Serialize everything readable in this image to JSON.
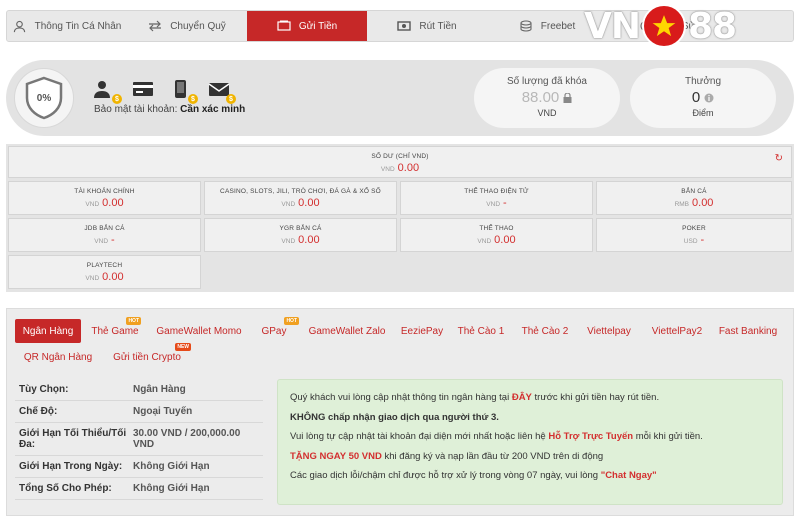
{
  "nav": {
    "tabs": [
      {
        "label": "Thông Tin Cá Nhân",
        "icon": "user-icon"
      },
      {
        "label": "Chuyển Quỹ",
        "icon": "transfer-icon"
      },
      {
        "label": "Gửi Tiền",
        "icon": "deposit-icon",
        "active": true
      },
      {
        "label": "Rút Tiền",
        "icon": "withdraw-icon"
      },
      {
        "label": "Freebet",
        "icon": "coins-icon"
      },
      {
        "label": "Lịch Sử",
        "icon": "history-icon"
      }
    ],
    "brand_left": "VN",
    "brand_right": "88"
  },
  "profile": {
    "security_percent": "0%",
    "security_label": "Bảo mật tài khoản:",
    "security_status": "Cần xác minh",
    "security_icons": [
      "user-verify-icon",
      "card-icon",
      "phone-verify-icon",
      "email-verify-icon"
    ],
    "locked": {
      "title": "Số lượng đã khóa",
      "value": "88.00",
      "unit": "VND"
    },
    "reward": {
      "title": "Thưởng",
      "value": "0",
      "unit": "Điểm"
    }
  },
  "balance": {
    "main": {
      "label": "SỐ DƯ (CHỈ VND)",
      "currency": "VND",
      "amount": "0.00"
    },
    "wallets": [
      {
        "label": "TÀI KHOẢN CHÍNH",
        "currency": "VND",
        "amount": "0.00"
      },
      {
        "label": "CASINO, SLOTS, JILI, TRÒ CHƠI, ĐÁ GÀ & XỔ SỐ",
        "currency": "VND",
        "amount": "0.00"
      },
      {
        "label": "THỂ THAO ĐIỆN TỬ",
        "currency": "VND",
        "amount": "-"
      },
      {
        "label": "BẮN CÁ",
        "currency": "RMB",
        "amount": "0.00"
      },
      {
        "label": "JDB BẮN CÁ",
        "currency": "VND",
        "amount": "-"
      },
      {
        "label": "YGR BẮN CÁ",
        "currency": "VND",
        "amount": "0.00"
      },
      {
        "label": "THỂ THAO",
        "currency": "VND",
        "amount": "0.00"
      },
      {
        "label": "POKER",
        "currency": "USD",
        "amount": "-"
      },
      {
        "label": "PLAYTECH",
        "currency": "VND",
        "amount": "0.00"
      }
    ]
  },
  "deposit": {
    "methods": [
      {
        "label": "Ngân Hàng",
        "active": true
      },
      {
        "label": "Thẻ Game",
        "badge": "HOT"
      },
      {
        "label": "GameWallet Momo"
      },
      {
        "label": "GPay",
        "badge": "HOT"
      },
      {
        "label": "GameWallet Zalo"
      },
      {
        "label": "EeziePay"
      },
      {
        "label": "Thẻ Cào 1"
      },
      {
        "label": "Thẻ Cào 2"
      },
      {
        "label": "Viettelpay"
      },
      {
        "label": "ViettelPay2"
      },
      {
        "label": "Fast Banking"
      },
      {
        "label": "QR Ngân Hàng"
      },
      {
        "label": "Gửi tiền Crypto",
        "badge": "NEW"
      }
    ],
    "info": [
      {
        "key": "Tùy Chọn:",
        "value": "Ngân Hàng"
      },
      {
        "key": "Chế Độ:",
        "value": "Ngoại Tuyến"
      },
      {
        "key": "Giới Hạn Tối Thiểu/Tối Đa:",
        "value": "30.00 VND / 200,000.00 VND"
      },
      {
        "key": "Giới Hạn Trong Ngày:",
        "value": "Không Giới Hạn"
      },
      {
        "key": "Tổng Số Cho Phép:",
        "value": "Không Giới Hạn"
      }
    ],
    "notice": {
      "l1_a": "Quý khách vui lòng cập nhật thông tin ngân hàng tại ",
      "l1_link": "ĐÂY",
      "l1_b": " trước khi gửi tiền hay rút tiền.",
      "l2": "KHÔNG chấp nhận giao dịch qua người thứ 3.",
      "l3_a": "Vui lòng tự cập nhật tài khoản đại diện mới nhất hoặc liên hệ ",
      "l3_link": "Hỗ Trợ Trực Tuyến",
      "l3_b": " mỗi khi gửi tiền.",
      "l4_a": "TẶNG NGAY 50 VND",
      "l4_b": " khi đăng ký và nạp lần đầu từ 200 VND trên di động",
      "l5_a": "Các giao dịch lỗi/chậm chỉ được hỗ trợ xử lý trong vòng 07 ngày, vui lòng ",
      "l5_link": "\"Chat Ngay\""
    }
  }
}
